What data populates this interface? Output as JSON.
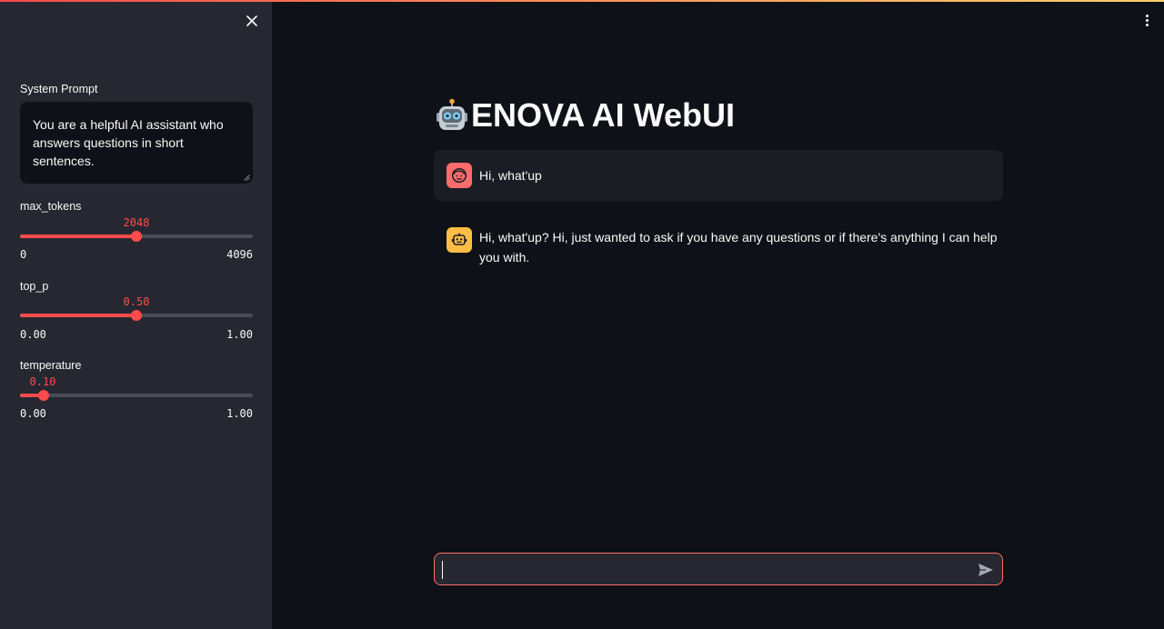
{
  "app": {
    "title": "ENOVA AI WebUI"
  },
  "sidebar": {
    "system_prompt_label": "System Prompt",
    "system_prompt_value": "You are a helpful AI assistant who answers questions in short sentences.",
    "sliders": [
      {
        "label": "max_tokens",
        "value": "2048",
        "min": "0",
        "max": "4096",
        "fraction": 0.5
      },
      {
        "label": "top_p",
        "value": "0.50",
        "min": "0.00",
        "max": "1.00",
        "fraction": 0.5
      },
      {
        "label": "temperature",
        "value": "0.10",
        "min": "0.00",
        "max": "1.00",
        "fraction": 0.1
      }
    ]
  },
  "chat": {
    "messages": [
      {
        "role": "user",
        "avatar_icon": "user-face-icon",
        "text": "Hi, what'up"
      },
      {
        "role": "assistant",
        "avatar_icon": "robot-icon",
        "text": "Hi, what'up? Hi, just wanted to ask if you have any questions or if there's anything I can help you with."
      }
    ],
    "input_value": ""
  },
  "colors": {
    "accent": "#ff4b4b",
    "sidebar_bg": "#262730",
    "main_bg": "#0e1117",
    "user_avatar": "#ff6c6c",
    "bot_avatar": "#ffbd45"
  }
}
